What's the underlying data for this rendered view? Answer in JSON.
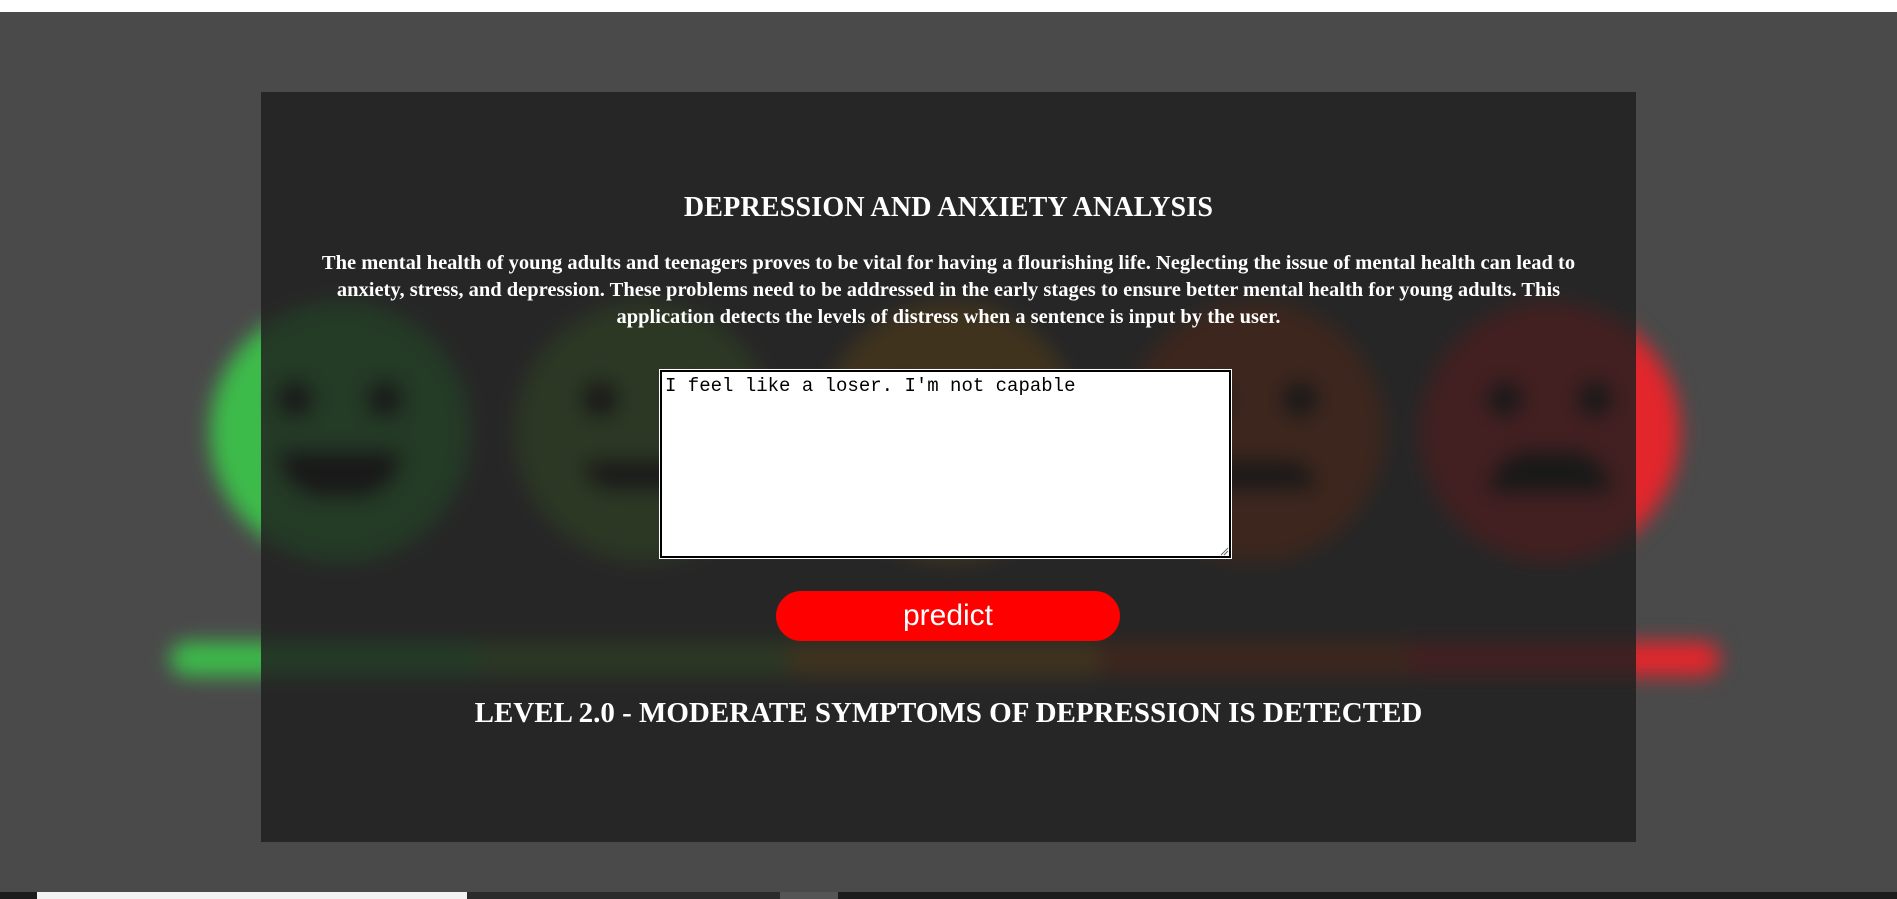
{
  "header": {
    "title": "DEPRESSION AND ANXIETY ANALYSIS"
  },
  "intro": {
    "text": "The mental health of young adults and teenagers proves to be vital for having a flourishing life. Neglecting the issue of mental health can lead to anxiety, stress, and depression. These problems need to be addressed in the early stages to ensure better mental health for young adults. This application detects the levels of distress when a sentence is input by the user."
  },
  "input": {
    "value": "I feel like a loser. I'm not capable"
  },
  "actions": {
    "predict_label": "predict"
  },
  "result": {
    "text": "LEVEL 2.0 - MODERATE SYMPTOMS OF DEPRESSION IS DETECTED"
  },
  "colors": {
    "page_background": "#4a4a4a",
    "panel_background": "#1e1e1e",
    "predict_button": "#ff0000",
    "scale": [
      "#3dbb4a",
      "#6aa83f",
      "#d4901f",
      "#c44a1c",
      "#e3262c"
    ]
  },
  "background_illustration": {
    "faces": [
      "very-happy-face-icon",
      "happy-face-icon",
      "neutral-face-icon",
      "sad-face-icon",
      "distressed-face-icon"
    ]
  }
}
